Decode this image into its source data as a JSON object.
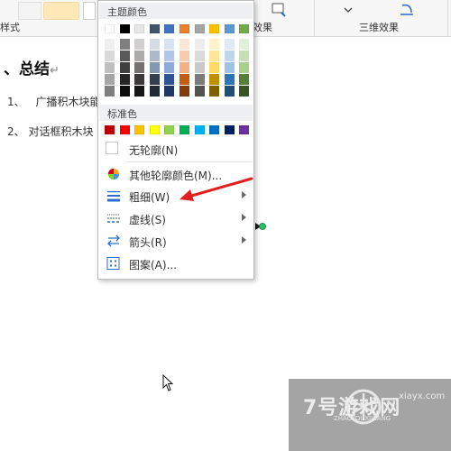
{
  "ribbon": {
    "left_label": "样式",
    "mid_label": "效果",
    "right_label": "三维效果"
  },
  "document": {
    "heading": "、总结",
    "items": [
      {
        "num": "1、",
        "text": "广播积木块能"
      },
      {
        "num": "2、",
        "text": "对话框积木块"
      }
    ]
  },
  "menu": {
    "theme_title": "主题颜色",
    "standard_title": "标准色",
    "no_outline": "无轮廓(N)",
    "other_color": "其他轮廓颜色(M)...",
    "weight": "粗细(W)",
    "dash": "虚线(S)",
    "arrow": "箭头(R)",
    "pattern": "图案(A)...",
    "theme_colors": [
      [
        "#ffffff",
        "#efefef",
        "#d9d9d9",
        "#bfbfbf",
        "#a6a6a6",
        "#808080"
      ],
      [
        "#000000",
        "#7f7f7f",
        "#595959",
        "#404040",
        "#262626",
        "#0d0d0d"
      ],
      [
        "#e7e6e6",
        "#d0cece",
        "#aeabab",
        "#767171",
        "#3a3838",
        "#171616"
      ],
      [
        "#44546a",
        "#d6dce4",
        "#adb9ca",
        "#8497b0",
        "#333f4f",
        "#222a35"
      ],
      [
        "#4472c4",
        "#d9e2f3",
        "#b4c6e7",
        "#8eaadb",
        "#2f5496",
        "#1f3864"
      ],
      [
        "#ed7d31",
        "#fbe5d5",
        "#f7cbac",
        "#f4b083",
        "#c55a11",
        "#833c0b"
      ],
      [
        "#a5a5a5",
        "#ededed",
        "#dbdbdb",
        "#c9c9c9",
        "#7b7b7b",
        "#525252"
      ],
      [
        "#ffc000",
        "#fff2cc",
        "#fee599",
        "#ffd965",
        "#bf9000",
        "#7f6000"
      ],
      [
        "#5b9bd5",
        "#deebf6",
        "#bdd7ee",
        "#9cc3e5",
        "#2e75b5",
        "#1f4e79"
      ],
      [
        "#70ad47",
        "#e2efd9",
        "#c5e0b3",
        "#a8d08d",
        "#538135",
        "#375623"
      ]
    ],
    "standard_colors": [
      "#c00000",
      "#ff0000",
      "#ffc000",
      "#ffff00",
      "#92d050",
      "#00b050",
      "#00b0f0",
      "#0070c0",
      "#002060",
      "#7030a0"
    ]
  },
  "annotation": {
    "arrow_color": "#e02020"
  },
  "watermark": {
    "domain": "7号游戏网",
    "sub": "ZHAOYOUXIWANG",
    "url": "xiayx.com"
  }
}
